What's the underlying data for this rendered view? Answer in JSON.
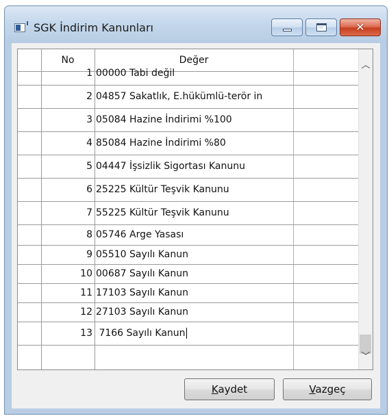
{
  "window": {
    "title": "SGK İndirim Kanunları",
    "close_glyph": "✕"
  },
  "grid": {
    "columns": [
      "No",
      "Değer"
    ],
    "rows": [
      {
        "no": "1",
        "value": "00000 Tabi değil"
      },
      {
        "no": "2",
        "value": "04857 Sakatlık, E.hükümlü-terör in"
      },
      {
        "no": "3",
        "value": "05084 Hazine İndirimi %100"
      },
      {
        "no": "4",
        "value": "85084 Hazine İndirimi %80"
      },
      {
        "no": "5",
        "value": "04447 İşsizlik Sigortası Kanunu"
      },
      {
        "no": "6",
        "value": "25225 Kültür Teşvik Kanunu"
      },
      {
        "no": "7",
        "value": "55225 Kültür Teşvik Kanunu"
      },
      {
        "no": "8",
        "value": "05746 Arge Yasası"
      },
      {
        "no": "9",
        "value": "05510 Sayılı Kanun"
      },
      {
        "no": "10",
        "value": "00687 Sayılı Kanun"
      },
      {
        "no": "11",
        "value": "17103 Sayılı Kanun"
      },
      {
        "no": "12",
        "value": "27103 Sayılı Kanun"
      },
      {
        "no": "13",
        "value": " 7166 Sayılı Kanun"
      }
    ],
    "editing_row": "13",
    "scroll_up_glyph": "︿",
    "scroll_down_glyph": "﹀"
  },
  "buttons": {
    "save": {
      "accel": "K",
      "rest": "aydet"
    },
    "cancel": {
      "accel": "V",
      "rest": "azgeç"
    }
  },
  "colors": {
    "highlight_border": "#c0282d",
    "close_button": "#c7401f"
  },
  "icons": {
    "app": "window-app-icon",
    "minimize": "minimize-icon",
    "maximize": "maximize-icon",
    "close": "close-icon"
  }
}
